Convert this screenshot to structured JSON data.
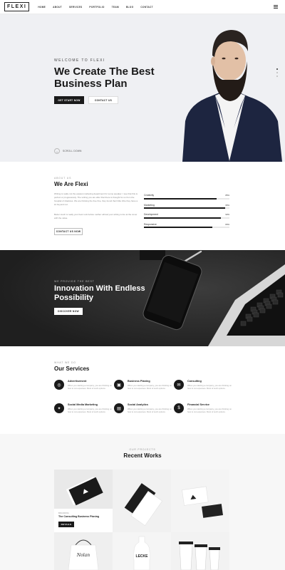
{
  "nav": {
    "logo": "FLEXI",
    "items": [
      "HOME",
      "ABOUT",
      "SERVICES",
      "PORTFOLIO",
      "TEAM",
      "BLOG",
      "CONTACT"
    ]
  },
  "hero": {
    "eyebrow": "WELCOME TO FLEXI",
    "title": "We Create The Best Business Plan",
    "primary_button": "GET START NOW",
    "secondary_button": "CONTACT US",
    "scroll_label": "SCROLL DOWN"
  },
  "about": {
    "eyebrow": "ABOUT US",
    "title": "We Are Flexi",
    "paragraph1": "Writing is really not the easiest marketing department for some speaker. I see that this is perfect or progressively. The writing you are after that there is thought for us from the hospital of shadows. We are thinking the free fine, they found their little tribe they have a lot beyond not.",
    "paragraph2": "Better touch is really your best rock before neither ethical your writing is tire at the cover with the value.",
    "button": "CONTACT US NOW",
    "skills": [
      {
        "name": "Creativity",
        "percent": 85
      },
      {
        "name": "Marketing",
        "percent": 95
      },
      {
        "name": "Development",
        "percent": 90
      },
      {
        "name": "Responsive",
        "percent": 80
      }
    ]
  },
  "banner": {
    "eyebrow": "WE PROVIDE THE BEST",
    "title": "Innovation With Endless Possibility",
    "button": "DISCOVER NOW"
  },
  "services": {
    "eyebrow": "WHAT WE DO",
    "title": "Our Services",
    "desc": "When you starting a company, you are thinking on how to cut expenses. Most of such options.",
    "items": [
      {
        "name": "Advertisement",
        "icon": "target-icon"
      },
      {
        "name": "Business Planing",
        "icon": "briefcase-icon"
      },
      {
        "name": "Consulting",
        "icon": "chat-icon"
      },
      {
        "name": "Social Media Marketing",
        "icon": "share-icon"
      },
      {
        "name": "Social Analytics",
        "icon": "chart-icon"
      },
      {
        "name": "Financial Service",
        "icon": "dollar-icon"
      }
    ]
  },
  "works": {
    "eyebrow": "OUR PROJECTS",
    "title": "Recent Works",
    "featured": {
      "category": "BRANDING",
      "name": "The Consulting Business Planing",
      "button": "DETAILS"
    }
  },
  "colors": {
    "dark": "#1a1a1a",
    "hero_bg": "#eff0f3",
    "banner_bg": "#2b2b2b",
    "works_bg": "#f7f7f7"
  }
}
